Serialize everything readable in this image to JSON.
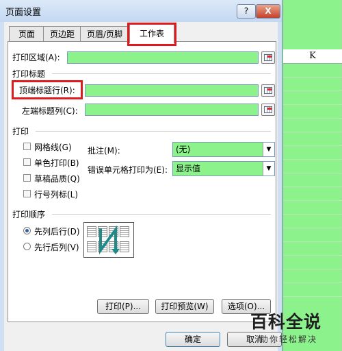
{
  "window": {
    "title": "页面设置",
    "help_label": "?",
    "close_label": "X"
  },
  "tabs": [
    {
      "label": "页面"
    },
    {
      "label": "页边距"
    },
    {
      "label": "页眉/页脚"
    },
    {
      "label": "工作表",
      "active": true
    }
  ],
  "sheet": {
    "column_header": "K"
  },
  "print_area": {
    "label": "打印区域(A):"
  },
  "print_titles": {
    "group_label": "打印标题",
    "rows_label": "顶端标题行(R):",
    "cols_label": "左端标题列(C):"
  },
  "print": {
    "group_label": "打印",
    "gridlines": "网格线(G)",
    "black_white": "单色打印(B)",
    "draft": "草稿品质(Q)",
    "row_col_headings": "行号列标(L)",
    "comments_label": "批注(M):",
    "comments_value": "(无)",
    "errors_label": "错误单元格打印为(E):",
    "errors_value": "显示值"
  },
  "page_order": {
    "group_label": "打印顺序",
    "down_then_over": "先列后行(D)",
    "over_then_down": "先行后列(V)",
    "selected": "down_then_over"
  },
  "buttons": {
    "print": "打印(P)...",
    "preview": "打印预览(W)",
    "options": "选项(O)...",
    "ok": "确定",
    "cancel": "取消"
  },
  "watermark": {
    "logo": "百科全说",
    "sub": "助你轻松解决"
  },
  "colors": {
    "highlight_green": "#8cf28c",
    "annotation_red": "#e0191f"
  }
}
